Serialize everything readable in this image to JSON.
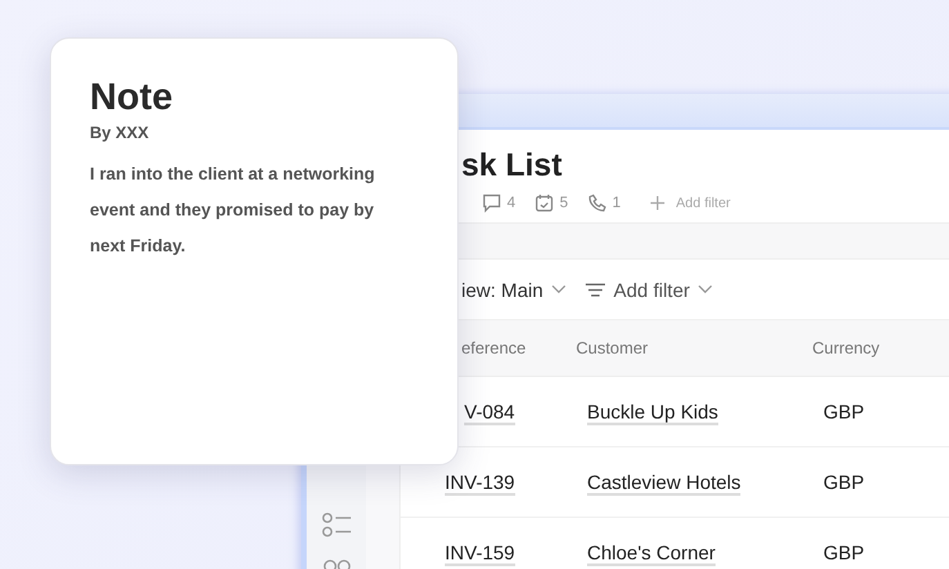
{
  "note": {
    "title": "Note",
    "author": "By XXX",
    "body": "I ran into the client at a networking event and they promised to pay by next Friday."
  },
  "page": {
    "title": "sk List",
    "counts": [
      {
        "kind": "comments",
        "value": "4"
      },
      {
        "kind": "tasks",
        "value": "5"
      },
      {
        "kind": "calls",
        "value": "1"
      }
    ],
    "add_filter": "Add filter"
  },
  "toolbar": {
    "view": "iew: Main",
    "filter": "Add filter"
  },
  "table": {
    "columns": [
      "eference",
      "Customer",
      "Currency"
    ],
    "rows": [
      {
        "reference": "V-084",
        "customer": "Buckle Up Kids",
        "currency": "GBP"
      },
      {
        "reference": "INV-139",
        "customer": "Castleview Hotels",
        "currency": "GBP"
      },
      {
        "reference": "INV-159",
        "customer": "Chloe's Corner",
        "currency": "GBP"
      }
    ]
  }
}
